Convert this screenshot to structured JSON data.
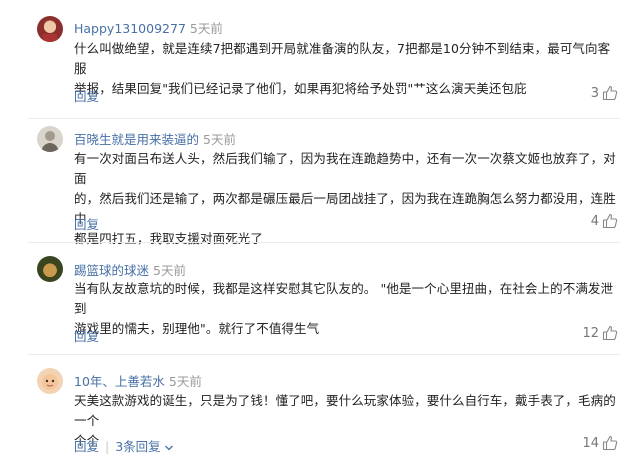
{
  "comments": [
    {
      "username": "Happy131009277",
      "time": "5天前",
      "lines": [
        "什么叫做绝望，就是连续7把都遇到开局就准备演的队友，7把都是10分钟不到结束，最可气向客服",
        "举报，结果回复\"我们已经记录了他们，如果再犯将给予处罚\"艹这么演天美还包庇"
      ],
      "reply_label": "回复",
      "likes": "3",
      "avatar_color": "#8b2e2e"
    },
    {
      "username": "百晓生就是用来装逼的",
      "time": "5天前",
      "lines": [
        "有一次对面吕布送人头，然后我们输了，因为我在连跪趋势中，还有一次一次蔡文姬也放弃了，对面",
        "的，然后我们还是输了，两次都是碾压最后一局团战挂了，因为我在连跪胸怎么努力都没用，连胜中",
        "都是四打五，我取支援对面死光了"
      ],
      "reply_label": "回复",
      "likes": "4",
      "avatar_color": "#b9b3a8"
    },
    {
      "username": "踢篮球的球迷",
      "time": "5天前",
      "lines": [
        "当有队友故意坑的时候，我都是这样安慰其它队友的。 \"他是一个心里扭曲，在社会上的不满发泄到",
        "游戏里的懦夫，别理他\"。就行了不值得生气"
      ],
      "reply_label": "回复",
      "likes": "12",
      "avatar_color": "#4f5a2c"
    },
    {
      "username": "10年、上善若水",
      "time": "5天前",
      "lines": [
        "天美这款游戏的诞生，只是为了钱！懂了吧，要什么玩家体验，要什么自行车，戴手表了，毛病的一个",
        "个个"
      ],
      "reply_label": "回复",
      "sub_reply_label": "3条回复",
      "likes": "14",
      "avatar_color": "#e8b98a"
    }
  ],
  "icons": {
    "like": "thumbs-up-icon",
    "expand": "chevron-down-icon"
  },
  "colors": {
    "username": "#4670a6",
    "time": "#9a9a9a",
    "body": "#222222",
    "divider": "#ececec"
  }
}
